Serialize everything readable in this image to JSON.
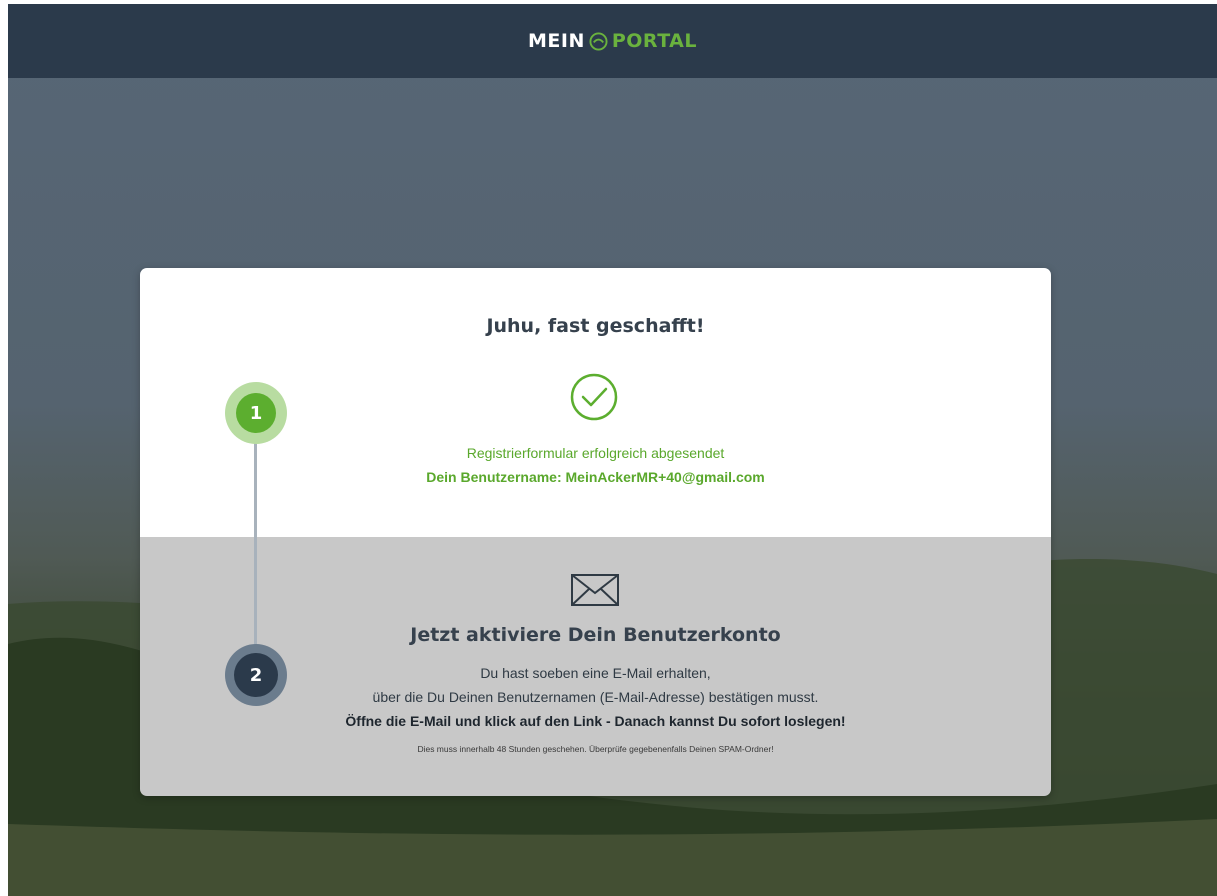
{
  "header": {
    "logo_left": "MEIN",
    "logo_right": "PORTAL",
    "logo_icon": "leaf-circle-icon"
  },
  "step1": {
    "number": "1",
    "title": "Juhu, fast geschafft!",
    "icon": "check-circle-icon",
    "message": "Registrierformular erfolgreich abgesendet",
    "username_line": "Dein Benutzername: MeinAckerMR+40@gmail.com"
  },
  "step2": {
    "number": "2",
    "icon": "envelope-icon",
    "title": "Jetzt aktiviere Dein Benutzerkonto",
    "line1": "Du hast soeben eine E-Mail erhalten,",
    "line2": "über die Du Deinen Benutzernamen (E-Mail-Adresse) bestätigen musst.",
    "line3": "Öffne die E-Mail und klick auf den Link - Danach kannst Du sofort loslegen!",
    "note": "Dies muss innerhalb 48 Stunden geschehen. Überprüfe gegebenenfalls Deinen SPAM-Ordner!"
  },
  "colors": {
    "header_bg": "#2b3a4b",
    "brand_green": "#6ab23e",
    "success_green": "#5aa82c",
    "card_bottom": "#c8c8c8"
  }
}
